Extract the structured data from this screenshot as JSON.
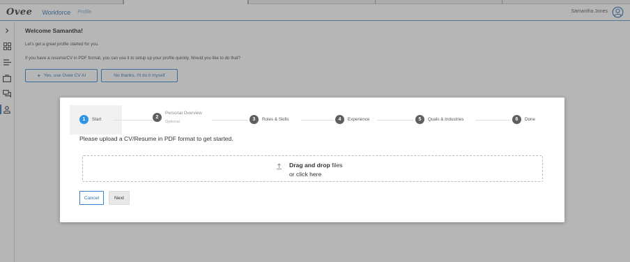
{
  "header": {
    "logo": "Ovee",
    "nav_workforce": "Workforce",
    "nav_profile": "Profile",
    "user_name": "Samantha Jones"
  },
  "rail": {
    "items": [
      "chevron-right-icon",
      "dashboard-icon",
      "list-icon",
      "briefcase-icon",
      "chat-icon",
      "person-icon"
    ]
  },
  "main": {
    "welcome": "Welcome Samantha!",
    "intro_line1": "Let's get a great profile started for you.",
    "intro_line2": "If you have a resume/CV in PDF format, you can use it to setup up your profile quickly. Would you like to do that?",
    "btn_ai": "Yes, use Ovee CV AI",
    "btn_self": "No thanks, I'll do it myself"
  },
  "modal": {
    "steps": [
      {
        "num": "1",
        "label": "Start"
      },
      {
        "num": "2",
        "label": "Personal Overview",
        "sublabel": "Optional"
      },
      {
        "num": "3",
        "label": "Roles & Skills"
      },
      {
        "num": "4",
        "label": "Experience"
      },
      {
        "num": "5",
        "label": "Quals & Industries"
      },
      {
        "num": "6",
        "label": "Done"
      }
    ],
    "current_step": 1,
    "upload_prompt": "Please upload a CV/Resume in PDF format to get started.",
    "dropzone": {
      "bold": "Drag and drop",
      "after_bold": " files",
      "line2": "or click here"
    },
    "cancel": "Cancel",
    "next": "Next"
  },
  "colors": {
    "accent": "#2f6fb0",
    "step_current": "#2e95e8",
    "step_default": "#5f5f5f"
  }
}
